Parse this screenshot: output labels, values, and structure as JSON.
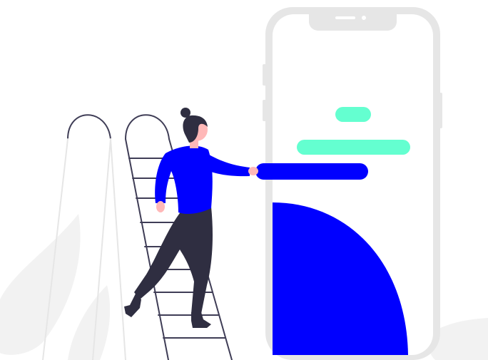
{
  "illustration": {
    "subject": "woman-climbing-ladder-to-phone",
    "colors": {
      "accent_blue": "#0000ff",
      "accent_mint": "#64ffd0",
      "phone_frame": "#e6e6e6",
      "phone_screen": "#ffffff",
      "ladder": "#3f3d56",
      "pants": "#2f2e41",
      "skin": "#ffb8b8",
      "leaf_shadow": "#f2f2f2"
    }
  }
}
